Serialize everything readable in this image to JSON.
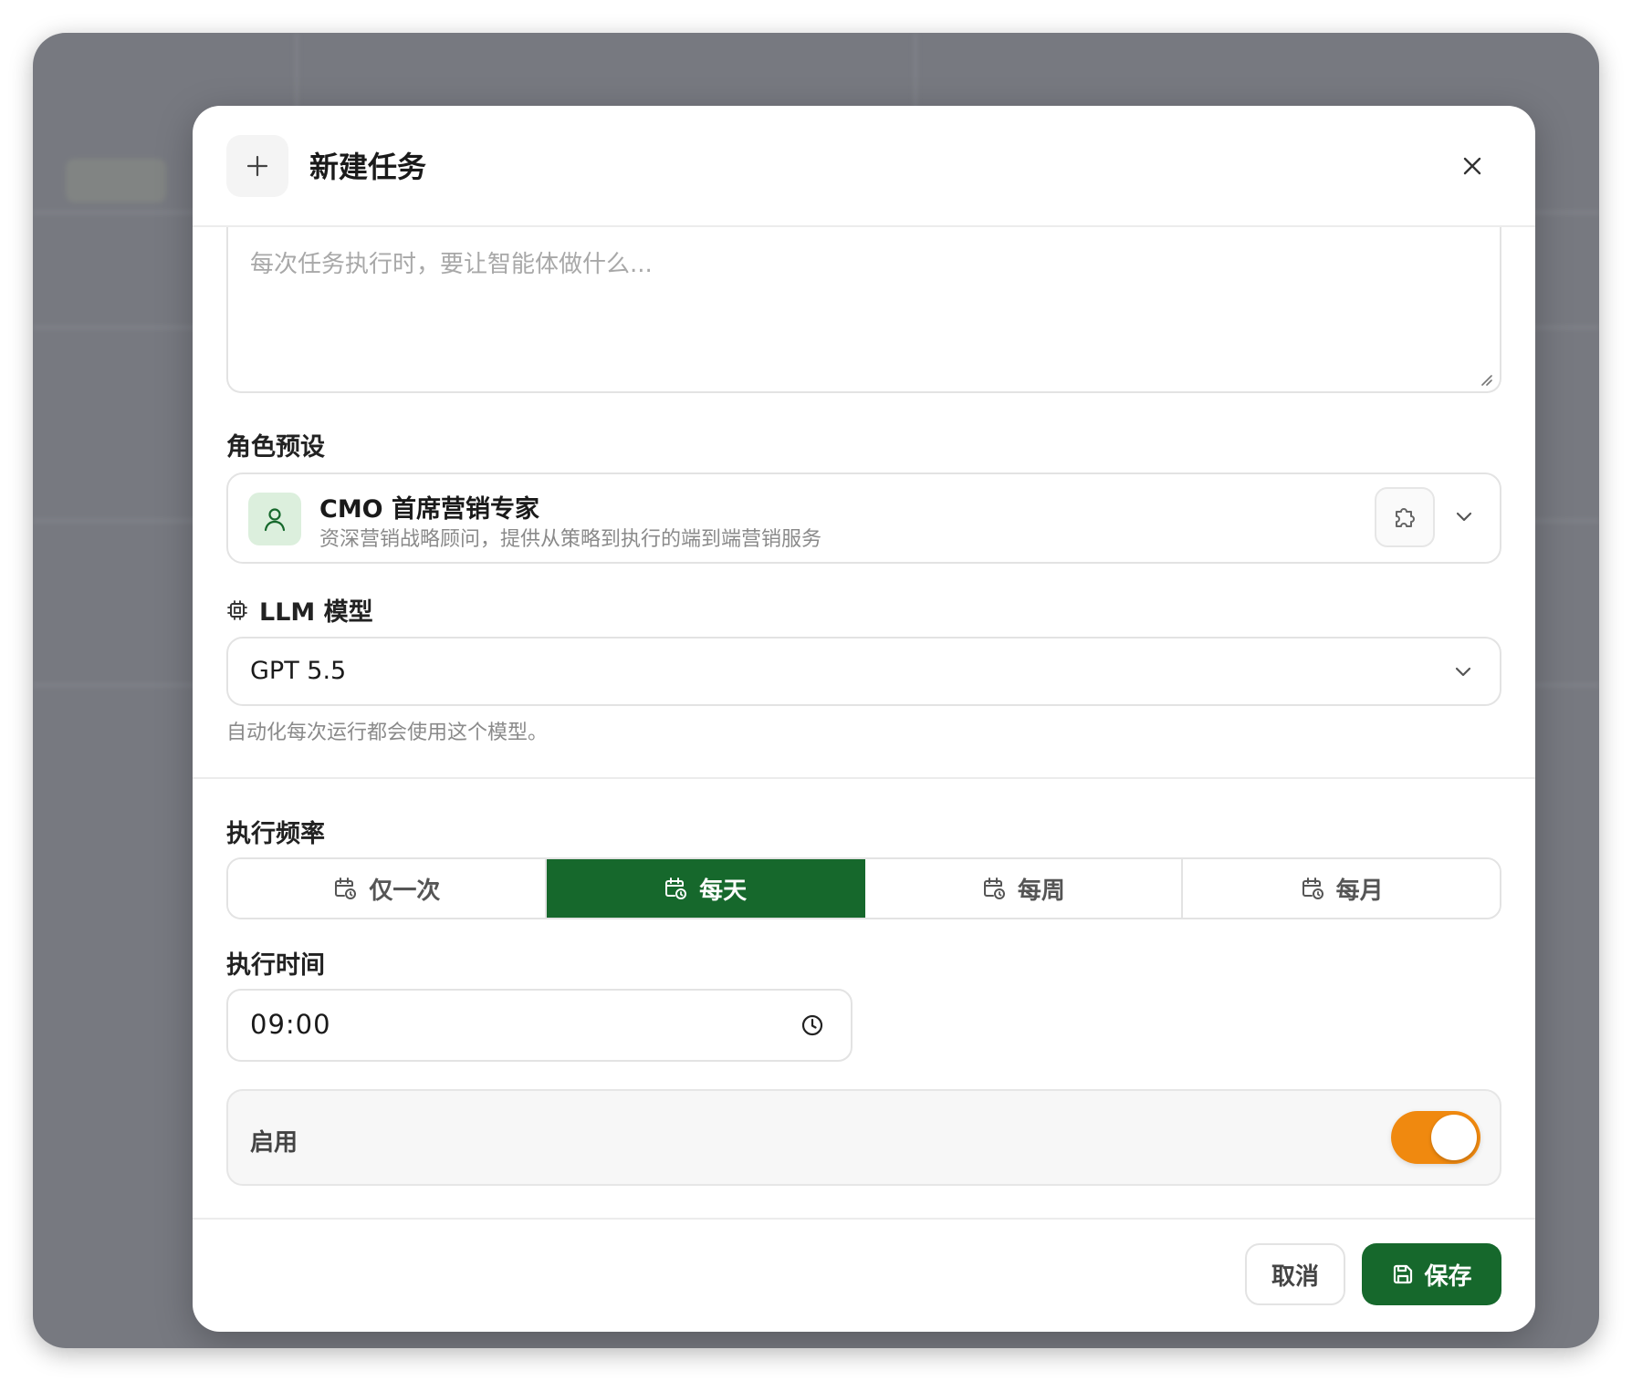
{
  "modal": {
    "title": "新建任务",
    "header_icon": "plus-icon",
    "close_icon": "close-icon"
  },
  "prompt": {
    "value": "",
    "placeholder": "每次任务执行时，要让智能体做什么..."
  },
  "role_preset": {
    "label": "角色预设",
    "selected_name": "CMO 首席营销专家",
    "selected_desc": "资深营销战略顾问，提供从策略到执行的端到端营销服务",
    "avatar_icon": "user-icon",
    "skill_icon": "puzzle-icon"
  },
  "llm": {
    "label": "LLM 模型",
    "icon": "cpu-chip-icon",
    "selected": "GPT 5.5",
    "hint": "自动化每次运行都会使用这个模型。"
  },
  "frequency": {
    "label": "执行频率",
    "options": [
      {
        "label": "仅一次",
        "active": false
      },
      {
        "label": "每天",
        "active": true
      },
      {
        "label": "每周",
        "active": false
      },
      {
        "label": "每月",
        "active": false
      }
    ],
    "icon": "calendar-clock-icon"
  },
  "schedule_time": {
    "label": "执行时间",
    "value": "09:00",
    "icon": "clock-icon"
  },
  "enabled": {
    "label": "启用",
    "value": true
  },
  "footer": {
    "cancel_label": "取消",
    "save_label": "保存",
    "save_icon": "save-icon"
  },
  "colors": {
    "primary_green": "#16682c",
    "toggle_orange": "#f0890f",
    "overlay": "#777980"
  }
}
